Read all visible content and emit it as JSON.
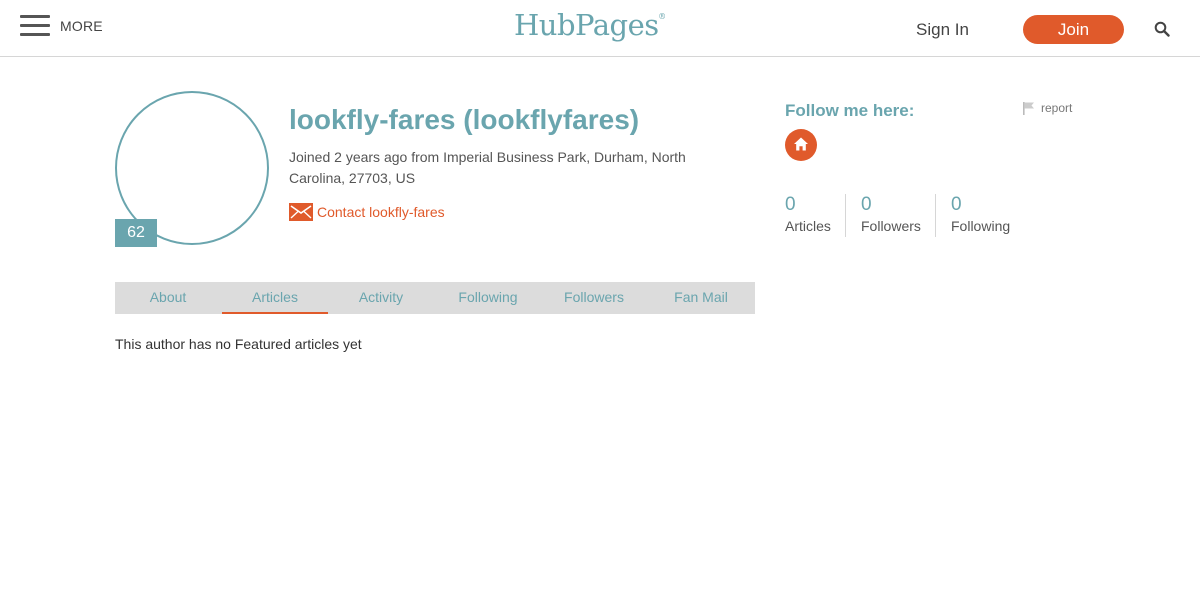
{
  "header": {
    "more_label": "MORE",
    "logo_text": "HubPages",
    "logo_mark": "®",
    "signin_label": "Sign In",
    "join_label": "Join"
  },
  "profile": {
    "name": "lookfly-fares (lookflyfares)",
    "joined": "Joined 2 years ago from Imperial Business Park, Durham, North Carolina, 27703, US",
    "contact_label": "Contact lookfly-fares",
    "score": "62"
  },
  "tabs": [
    "About",
    "Articles",
    "Activity",
    "Following",
    "Followers",
    "Fan Mail"
  ],
  "active_tab": "Articles",
  "empty_message": "This author has no Featured articles yet",
  "sidebar": {
    "follow_title": "Follow me here:",
    "report_label": "report",
    "stats": [
      {
        "value": "0",
        "label": "Articles"
      },
      {
        "value": "0",
        "label": "Followers"
      },
      {
        "value": "0",
        "label": "Following"
      }
    ]
  },
  "colors": {
    "accent": "#6aa5ae",
    "brand_orange": "#e05a2b",
    "tab_bar": "#dcdcdc"
  },
  "icons": [
    "hamburger-icon",
    "search-icon",
    "mail-icon",
    "flag-icon",
    "home-icon"
  ]
}
